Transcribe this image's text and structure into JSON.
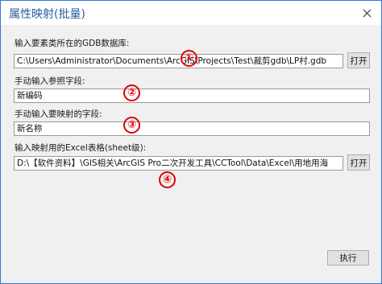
{
  "window": {
    "title": "属性映射(批量)"
  },
  "fields": [
    {
      "label": "输入要素类所在的GDB数据库:",
      "value": "C:\\Users\\Administrator\\Documents\\ArcGIS\\Projects\\Test\\裁剪gdb\\LP村.gdb",
      "button": "打开"
    },
    {
      "label": "手动输入参照字段:",
      "value": "新编码"
    },
    {
      "label": "手动输入要映射的字段:",
      "value": "新名称"
    },
    {
      "label": "输入映射用的Excel表格(sheet级):",
      "value": "D:\\【软件资料】\\GIS相关\\ArcGIS Pro二次开发工具\\CCTool\\Data\\Excel\\用地用海",
      "button": "打开"
    }
  ],
  "markers": [
    "①",
    "②",
    "③",
    "④"
  ],
  "run_button": "执行",
  "colors": {
    "accent_border": "#2b79d8",
    "title_text": "#2b5f9e",
    "marker": "#e00000"
  },
  "icons": {
    "close": "close-icon"
  }
}
